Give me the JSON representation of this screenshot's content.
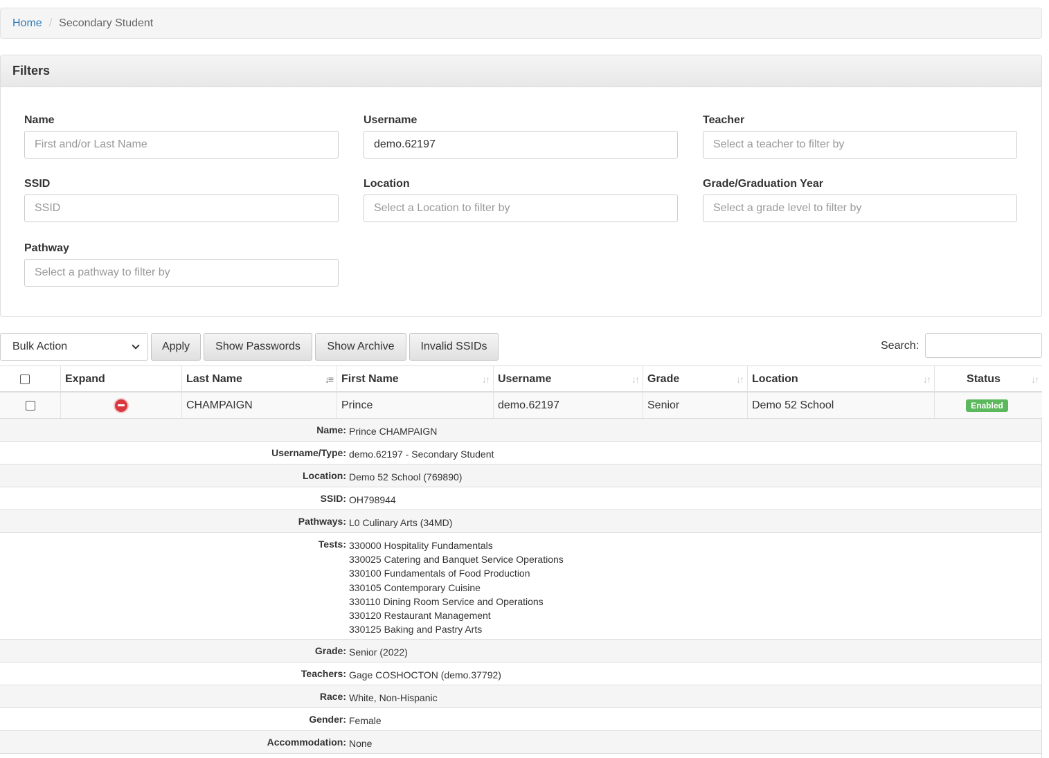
{
  "breadcrumb": {
    "home": "Home",
    "separator": "/",
    "current": "Secondary Student"
  },
  "filters": {
    "title": "Filters",
    "name": {
      "label": "Name",
      "placeholder": "First and/or Last Name"
    },
    "username": {
      "label": "Username",
      "value": "demo.62197"
    },
    "teacher": {
      "label": "Teacher",
      "placeholder": "Select a teacher to filter by"
    },
    "ssid": {
      "label": "SSID",
      "placeholder": "SSID"
    },
    "location": {
      "label": "Location",
      "placeholder": "Select a Location to filter by"
    },
    "grade": {
      "label": "Grade/Graduation Year",
      "placeholder": "Select a grade level to filter by"
    },
    "pathway": {
      "label": "Pathway",
      "placeholder": "Select a pathway to filter by"
    }
  },
  "toolbar": {
    "bulk_action": "Bulk Action",
    "apply": "Apply",
    "show_passwords": "Show Passwords",
    "show_archive": "Show Archive",
    "invalid_ssids": "Invalid SSIDs",
    "search_label": "Search:"
  },
  "table": {
    "headers": {
      "expand": "Expand",
      "last_name": "Last Name",
      "first_name": "First Name",
      "username": "Username",
      "grade": "Grade",
      "location": "Location",
      "status": "Status"
    },
    "row": {
      "last_name": "CHAMPAIGN",
      "first_name": "Prince",
      "username": "demo.62197",
      "grade": "Senior",
      "location": "Demo 52 School",
      "status": "Enabled"
    }
  },
  "details": {
    "name": {
      "key": "Name:",
      "value": "Prince CHAMPAIGN"
    },
    "username_type": {
      "key": "Username/Type:",
      "value": "demo.62197 - Secondary Student"
    },
    "location": {
      "key": "Location:",
      "value": "Demo 52 School (769890)"
    },
    "ssid": {
      "key": "SSID:",
      "value": "OH798944"
    },
    "pathways": {
      "key": "Pathways:",
      "value": "L0 Culinary Arts (34MD)"
    },
    "tests": {
      "key": "Tests:",
      "values": [
        "330000 Hospitality Fundamentals",
        "330025 Catering and Banquet Service Operations",
        "330100 Fundamentals of Food Production",
        "330105 Contemporary Cuisine",
        "330110 Dining Room Service and Operations",
        "330120 Restaurant Management",
        "330125 Baking and Pastry Arts"
      ]
    },
    "grade": {
      "key": "Grade:",
      "value": "Senior (2022)"
    },
    "teachers": {
      "key": "Teachers:",
      "value": "Gage COSHOCTON (demo.37792)"
    },
    "race": {
      "key": "Race:",
      "value": "White, Non-Hispanic"
    },
    "gender": {
      "key": "Gender:",
      "value": "Female"
    },
    "accommodation": {
      "key": "Accommodation:",
      "value": "None"
    }
  },
  "colors": {
    "link": "#337ab7",
    "status_enabled": "#5cb85c",
    "collapse_icon": "#d9363e"
  }
}
